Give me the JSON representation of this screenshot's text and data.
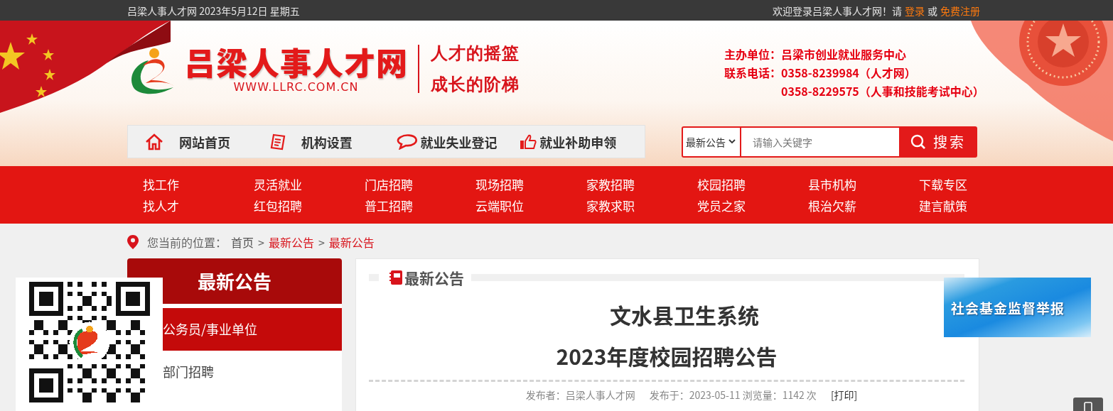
{
  "top_bar": {
    "date_text": "吕梁人事人才网 2023年5月12日 星期五",
    "welcome_text": "欢迎登录吕梁人事人才网！请",
    "login_link": "登录",
    "connector": "或",
    "register_link": "免费注册"
  },
  "header": {
    "site_name": "吕梁人事人才网",
    "site_url": "WWW.LLRC.COM.CN",
    "slogans": [
      "人才的摇篮",
      "成长的阶梯"
    ],
    "contact": {
      "sponsor_label": "主办单位：",
      "sponsor": "吕梁市创业就业服务中心",
      "phone_label": "联系电话：",
      "phones": [
        "0358-8239984（人才网）",
        "0358-8229575（人事和技能考试中心）"
      ]
    }
  },
  "main_nav": [
    {
      "label": "网站首页",
      "kind": "home"
    },
    {
      "label": "机构设置",
      "kind": "document"
    },
    {
      "label": "就业失业登记",
      "kind": "speech"
    },
    {
      "label": "就业补助申领",
      "kind": "thumb"
    }
  ],
  "search": {
    "category": "最新公告",
    "placeholder": "请输入关键字",
    "button": "搜索"
  },
  "menu_rows": [
    {
      "items": [
        "找工作",
        "灵活就业",
        "门店招聘",
        "现场招聘",
        "家教招聘",
        "校园招聘",
        "县市机构",
        "下载专区"
      ]
    },
    {
      "items": [
        "找人才",
        "红包招聘",
        "普工招聘",
        "云端职位",
        "家教求职",
        "党员之家",
        "根治欠薪",
        "建言献策"
      ]
    }
  ],
  "breadcrumb": {
    "prefix": "您当前的位置：",
    "separator": ">",
    "items": [
      {
        "label": "首页",
        "highlighted": false
      },
      {
        "label": "最新公告",
        "highlighted": true
      },
      {
        "label": "最新公告",
        "highlighted": true
      }
    ]
  },
  "sidebar": {
    "title": "最新公告",
    "items": [
      {
        "label": "公务员/事业单位",
        "selected": true
      },
      {
        "label": "部门招聘",
        "selected": false
      }
    ]
  },
  "article": {
    "section_title": "最新公告",
    "title_lines": [
      "文水县卫生系统",
      "2023年度校园招聘公告"
    ],
    "meta": {
      "publisher": "发布者：吕梁人事人才网",
      "published": "发布于：2023-05-11 浏览量：1142 次",
      "print": "[打印]"
    }
  },
  "report_banner": {
    "label": "社会基金监督举报"
  }
}
